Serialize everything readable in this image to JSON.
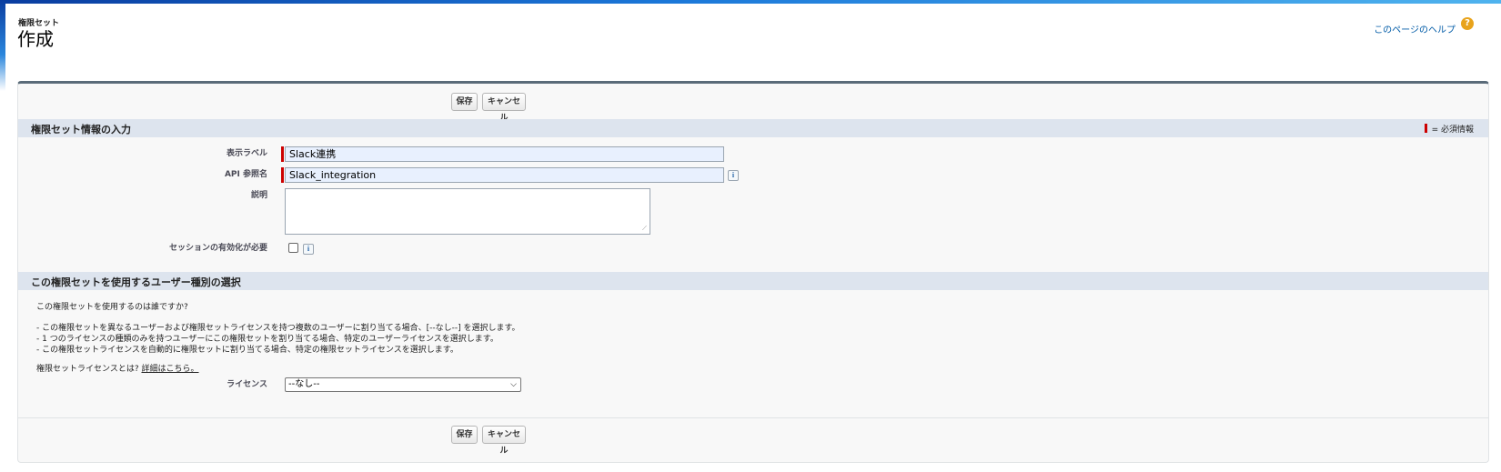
{
  "header": {
    "page_type": "権限セット",
    "title": "作成",
    "help_link": "このページのヘルプ",
    "help_icon": "question-icon"
  },
  "buttons": {
    "save": "保存",
    "cancel": "キャンセル"
  },
  "section1": {
    "title": "権限セット情報の入力",
    "required_legend": "= 必須情報",
    "fields": {
      "label": {
        "label": "表示ラベル",
        "value": "Slack連携"
      },
      "api_name": {
        "label": "API 参照名",
        "value": "Slack_integration"
      },
      "description": {
        "label": "説明",
        "value": ""
      },
      "session_activation": {
        "label": "セッションの有効化が必要",
        "checked": false
      }
    },
    "info_icon_glyph": "i"
  },
  "section2": {
    "title": "この権限セットを使用するユーザー種別の選択",
    "question": "この権限セットを使用するのは誰ですか?",
    "bullets": [
      "- この権限セットを異なるユーザーおよび権限セットライセンスを持つ複数のユーザーに割り当てる場合、[--なし--] を選択します。",
      "- 1 つのライセンスの種類のみを持つユーザーにこの権限セットを割り当てる場合、特定のユーザーライセンスを選択します。",
      "- この権限セットライセンスを自動的に権限セットに割り当てる場合、特定の権限セットライセンスを選択します。"
    ],
    "license_question": "権限セットライセンスとは?",
    "license_link": "詳細はこちら。",
    "license_label": "ライセンス",
    "license_value": "--なし--"
  },
  "colors": {
    "accent_bar": "#5a6b79",
    "section_header": "#dde4ee",
    "required": "#cc0000",
    "link": "#015ba7"
  }
}
